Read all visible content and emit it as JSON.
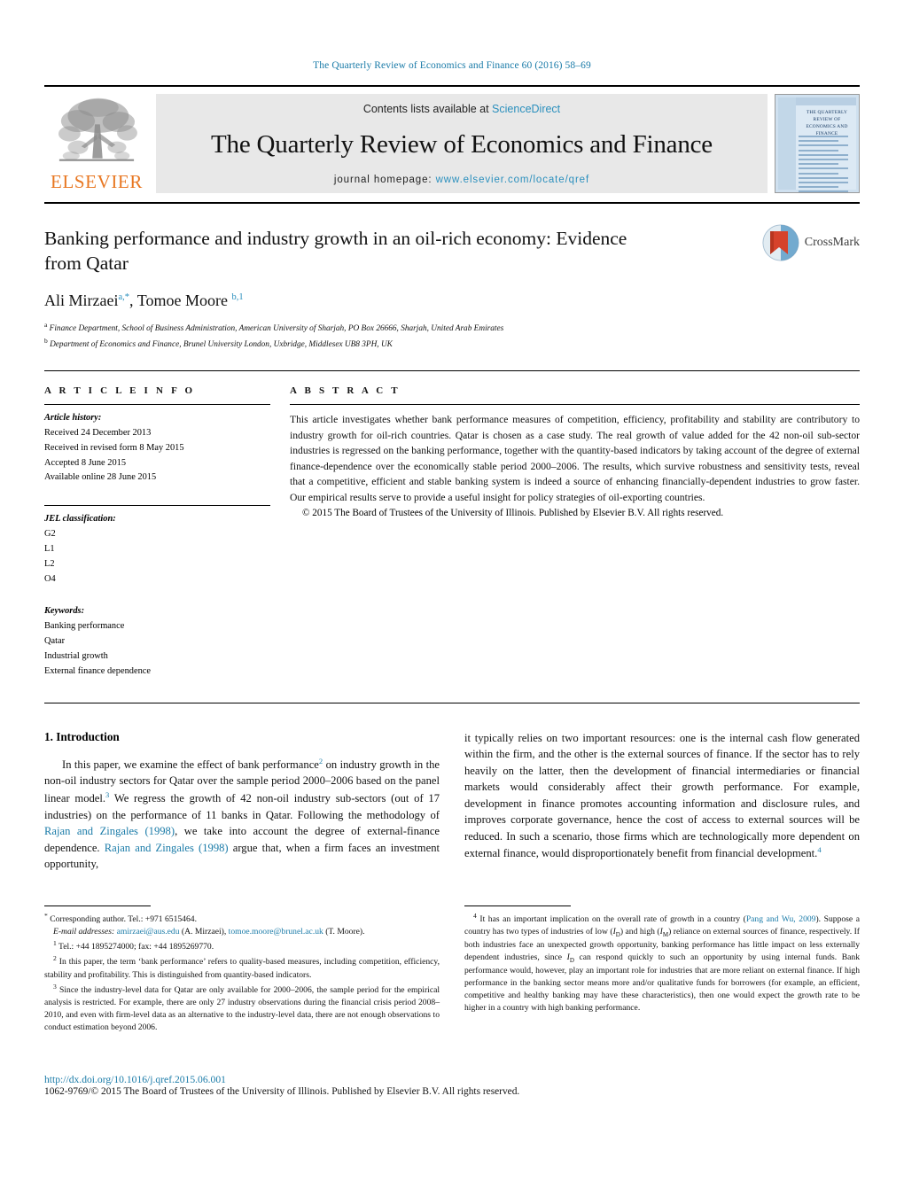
{
  "running_head": "The Quarterly Review of Economics and Finance 60 (2016) 58–69",
  "masthead": {
    "publisher": "ELSEVIER",
    "contents_prefix": "Contents lists available at ",
    "sciencedirect": "ScienceDirect",
    "journal_title": "The Quarterly Review of Economics and Finance",
    "homepage_prefix": "journal homepage: ",
    "homepage_url": "www.elsevier.com/locate/qref",
    "cover_title": "THE QUARTERLY REVIEW OF ECONOMICS AND FINANCE"
  },
  "article": {
    "title": "Banking performance and industry growth in an oil-rich economy: Evidence from Qatar",
    "authors": "Ali Mirzaei, Tomoe Moore",
    "author_1": "Ali Mirzaei",
    "author_1_sup": "a,*",
    "author_2": "Tomoe Moore",
    "author_2_sup": "b,1",
    "affiliation_a": "Finance Department, School of Business Administration, American University of Sharjah, PO Box 26666, Sharjah, United Arab Emirates",
    "affiliation_b": "Department of Economics and Finance, Brunel University London, Uxbridge, Middlesex UB8 3PH, UK",
    "crossmark_label": "CrossMark"
  },
  "article_info": {
    "heading": "A R T I C L E   I N F O",
    "history_label": "Article history:",
    "history": [
      "Received 24 December 2013",
      "Received in revised form 8 May 2015",
      "Accepted 8 June 2015",
      "Available online 28 June 2015"
    ],
    "jel_label": "JEL classification:",
    "jel": [
      "G2",
      "L1",
      "L2",
      "O4"
    ],
    "keywords_label": "Keywords:",
    "keywords": [
      "Banking performance",
      "Qatar",
      "Industrial growth",
      "External finance dependence"
    ]
  },
  "abstract": {
    "heading": "A B S T R A C T",
    "text": "This article investigates whether bank performance measures of competition, efficiency, profitability and stability are contributory to industry growth for oil-rich countries. Qatar is chosen as a case study. The real growth of value added for the 42 non-oil sub-sector industries is regressed on the banking performance, together with the quantity-based indicators by taking account of the degree of external finance-dependence over the economically stable period 2000–2006. The results, which survive robustness and sensitivity tests, reveal that a competitive, efficient and stable banking system is indeed a source of enhancing financially-dependent industries to grow faster. Our empirical results serve to provide a useful insight for policy strategies of oil-exporting countries.",
    "copyright": "© 2015 The Board of Trustees of the University of Illinois. Published by Elsevier B.V. All rights reserved."
  },
  "section": {
    "number_title": "1.  Introduction",
    "left_para_1a": "In this paper, we examine the effect of bank performance",
    "left_sup_2": "2",
    "left_para_1b": " on industry growth in the non-oil industry sectors for Qatar over the sample period 2000–2006 based on the panel linear model.",
    "left_sup_3": "3",
    "left_para_1c": " We regress the growth of 42 non-oil industry sub-sectors (out of 17 industries) on the performance of 11 banks in Qatar. Following the methodology of ",
    "cite_rz_1": "Rajan and Zingales (1998)",
    "left_para_1d": ", we take into account the degree of external-finance dependence. ",
    "cite_rz_2": "Rajan and Zingales (1998)",
    "left_para_1e": " argue that, when a firm faces an investment opportunity,",
    "right_para_1a": "it typically relies on two important resources: one is the internal cash flow generated within the firm, and the other is the external sources of finance. If the sector has to rely heavily on the latter, then the development of financial intermediaries or financial markets would considerably affect their growth performance. For example, development in finance promotes accounting information and disclosure rules, and improves corporate governance, hence the cost of access to external sources will be reduced. In such a scenario, those firms which are technologically more dependent on external finance, would disproportionately benefit from financial development.",
    "right_sup_4": "4"
  },
  "footnotes": {
    "corresponding_mark": "*",
    "corresponding": " Corresponding author. Tel.: +971 6515464.",
    "email_label": "E-mail addresses:",
    "email_1": "amirzaei@aus.edu",
    "email_1_name": " (A. Mirzaei), ",
    "email_2": "tomoe.moore@brunel.ac.uk",
    "email_2_name": " (T. Moore).",
    "fn1_mark": "1",
    "fn1": " Tel.: +44 1895274000; fax: +44 1895269770.",
    "fn2_mark": "2",
    "fn2": " In this paper, the term ‘bank performance’ refers to quality-based measures, including competition, efficiency, stability and profitability. This is distinguished from quantity-based indicators.",
    "fn3_mark": "3",
    "fn3": " Since the industry-level data for Qatar are only available for 2000–2006, the sample period for the empirical analysis is restricted. For example, there are only 27 industry observations during the financial crisis period 2008–2010, and even with firm-level data as an alternative to the industry-level data, there are not enough observations to conduct estimation beyond 2006.",
    "fn4_mark": "4",
    "fn4_a": " It has an important implication on the overall rate of growth in a country (",
    "fn4_cite": "Pang and Wu, 2009",
    "fn4_b": "). Suppose a country has two types of industries of low (",
    "fn4_var1": "I",
    "fn4_var1_sub": "D",
    "fn4_c": ") and high (",
    "fn4_var2": "I",
    "fn4_var2_sub": "M",
    "fn4_d": ") reliance on external sources of finance, respectively. If both industries face an unexpected growth opportunity, banking performance has little impact on less externally dependent industries, since ",
    "fn4_var3": "I",
    "fn4_var3_sub": "D",
    "fn4_e": " can respond quickly to such an opportunity by using internal funds. Bank performance would, however, play an important role for industries that are more reliant on external finance. If high performance in the banking sector means more and/or qualitative funds for borrowers (for example, an efficient, competitive and healthy banking may have these characteristics), then one would expect the growth rate to be higher in a country with high banking performance."
  },
  "bottom": {
    "doi": "http://dx.doi.org/10.1016/j.qref.2015.06.001",
    "issn_line": "1062-9769/© 2015 The Board of Trustees of the University of Illinois. Published by Elsevier B.V. All rights reserved."
  },
  "colors": {
    "link_blue": "#1a7ba8",
    "sciencedirect_blue": "#2a8fbd",
    "elsevier_orange": "#E87722",
    "masthead_grey": "#e8e8e8",
    "crossmark_red": "#d6422b",
    "crossmark_blue": "#5b9bc7"
  }
}
